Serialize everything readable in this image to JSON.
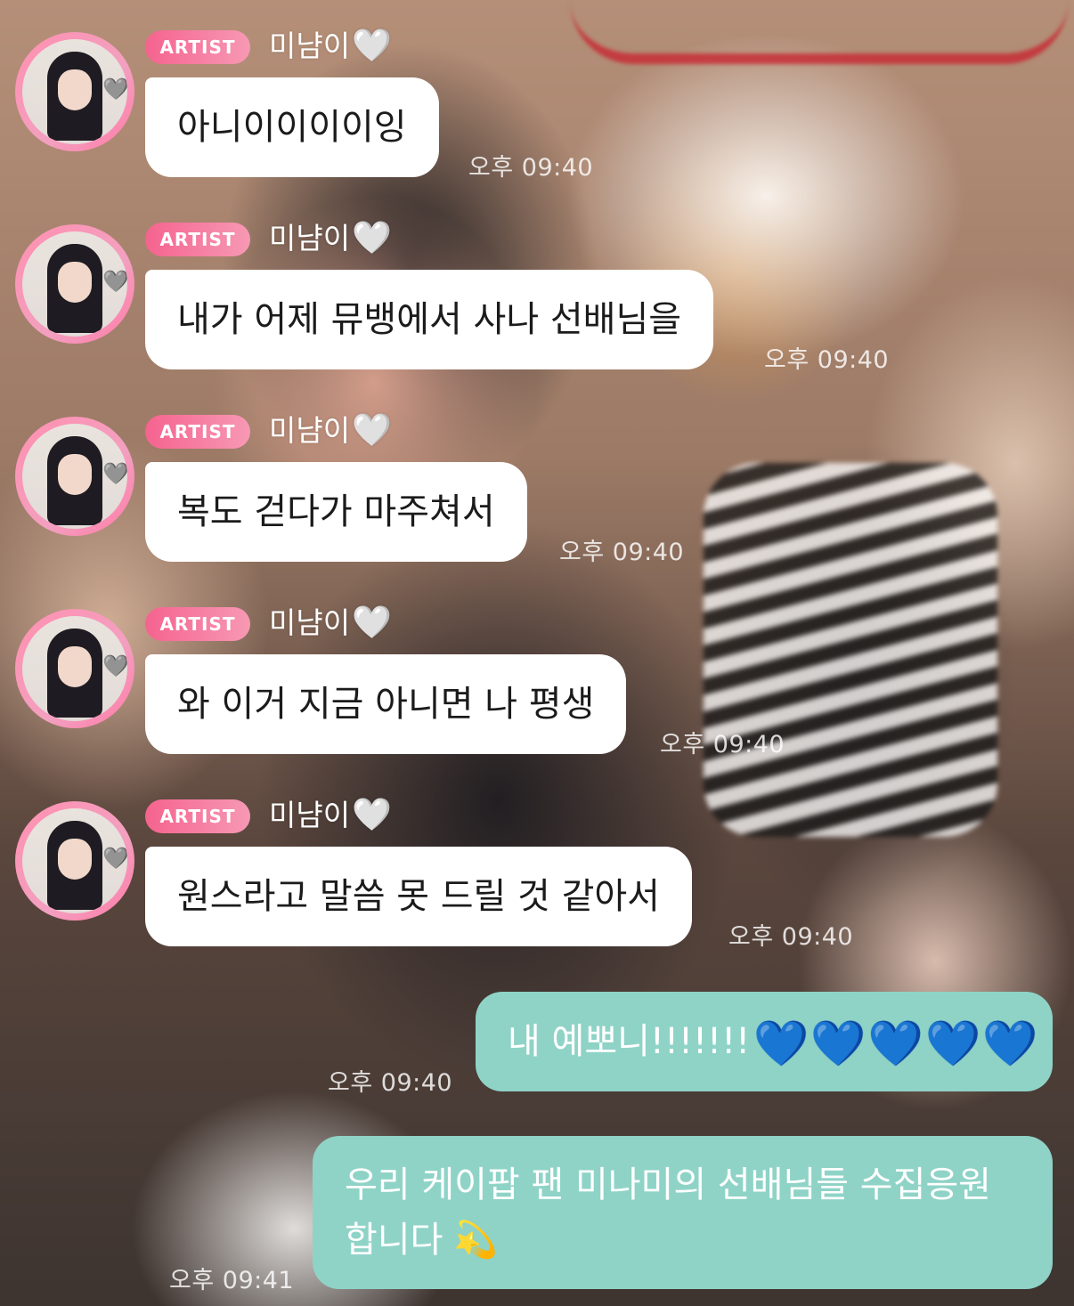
{
  "messages_in": [
    {
      "badge": "ARTIST",
      "name": "미냠이",
      "name_heart": "🤍",
      "avatar_heart": "🩶",
      "text": "아니이이이이잉",
      "time": "오후 09:40"
    },
    {
      "badge": "ARTIST",
      "name": "미냠이",
      "name_heart": "🤍",
      "avatar_heart": "🩶",
      "text": "내가 어제 뮤뱅에서 사나 선배님을",
      "time": "오후 09:40"
    },
    {
      "badge": "ARTIST",
      "name": "미냠이",
      "name_heart": "🤍",
      "avatar_heart": "🩶",
      "text": "복도 걷다가 마주쳐서",
      "time": "오후 09:40"
    },
    {
      "badge": "ARTIST",
      "name": "미냠이",
      "name_heart": "🤍",
      "avatar_heart": "🩶",
      "text": "와 이거 지금 아니면 나 평생",
      "time": "오후 09:40"
    },
    {
      "badge": "ARTIST",
      "name": "미냠이",
      "name_heart": "🤍",
      "avatar_heart": "🩶",
      "text": "원스라고 말씀 못 드릴 것 같아서",
      "time": "오후 09:40"
    }
  ],
  "messages_out": [
    {
      "text": "내 예뽀니!!!!!!!",
      "emoji": "💙💙💙💙💙",
      "time": "오후 09:40"
    },
    {
      "text_line1": "우리 케이팝 팬 미나미의 선배님들 수집응원",
      "text_line2": "합니다",
      "emoji": "💫",
      "time": "오후 09:41"
    }
  ],
  "colors": {
    "artist_badge": "#f5638f",
    "avatar_ring": "#ff8fb0",
    "bubble_in": "#ffffff",
    "bubble_out": "#8fd3c7",
    "heart_blue": "#1e73f0"
  }
}
